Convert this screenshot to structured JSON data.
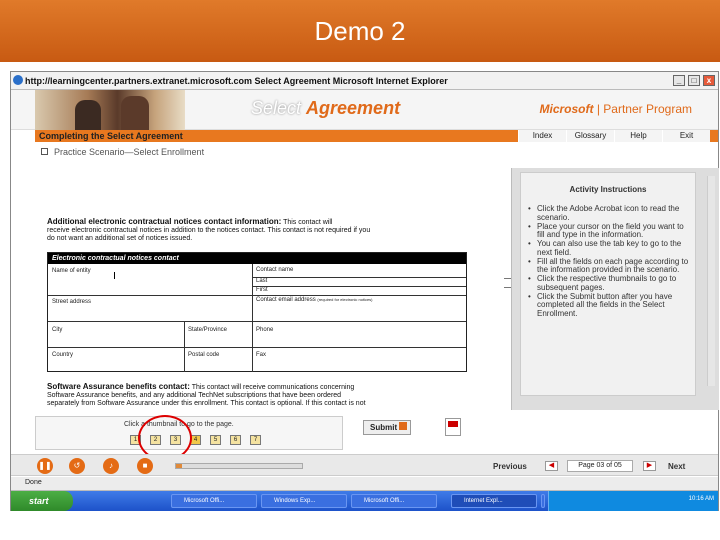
{
  "slide": {
    "title": "Demo 2"
  },
  "window": {
    "title": "http://learningcenter.partners.extranet.microsoft.com  Select Agreement  Microsoft Internet Explorer",
    "minimize": "_",
    "maximize": "□",
    "close": "x"
  },
  "banner": {
    "title_part1": "Select ",
    "title_part2": "Agreement",
    "brand": "Microsoft",
    "program": "| Partner Program"
  },
  "nav": {
    "section_title": "Completing the Select Agreement",
    "buttons": [
      "Index",
      "Glossary",
      "Help",
      "Exit"
    ]
  },
  "scenario": {
    "label": "Practice Scenario—Select Enrollment"
  },
  "form": {
    "contact_heading": "Additional electronic contractual notices contact information:",
    "contact_body_1": "This contact will",
    "contact_body_2": "receive electronic contractual notices in addition to the notices contact. This contact is not required if you",
    "contact_body_3": "do not want an additional set of notices issued.",
    "box_title": "Electronic contractual notices contact",
    "fields": {
      "name_of_entity": "Name of entity",
      "contact_name": "Contact name",
      "last": "Last",
      "first": "First",
      "contact_email": "Contact email address",
      "email_note": "(required for electronic notices)",
      "street_address": "Street address",
      "city": "City",
      "state_province": "State/Province",
      "phone": "Phone",
      "country": "Country",
      "postal_code": "Postal code",
      "fax": "Fax"
    },
    "sa_heading": "Software Assurance benefits contact:",
    "sa_body_1": "This contact will receive communications concerning",
    "sa_body_2": "Software Assurance benefits, and any additional TechNet subscriptions that have been ordered",
    "sa_body_3": "separately from Software Assurance under this enrollment. This contact is optional. If this contact is not"
  },
  "instructions": {
    "title": "Activity Instructions",
    "items": [
      "Click the Adobe Acrobat icon to read the scenario.",
      "Place your cursor on the field you want to fill and type in the information.",
      "You can also use the tab key to go to the next field.",
      "Fill all the fields on each page according to the information provided in the scenario.",
      "Click the respective thumbnails to go to subsequent pages.",
      "Click the Submit button after you have completed all the fields in the Select Enrollment."
    ]
  },
  "thumbnails": {
    "caption": "Click a thumbnail to go to the page.",
    "pages": [
      "1",
      "2",
      "3",
      "4",
      "5",
      "6",
      "7"
    ],
    "highlighted": "4"
  },
  "submit": {
    "label": "Submit"
  },
  "player": {
    "buttons": [
      "pause",
      "replay",
      "volume",
      "stop"
    ],
    "progress_fraction": 0.05,
    "previous_label": "Previous",
    "page_label": "Page 03 of 05",
    "next_label": "Next"
  },
  "status": {
    "text": "Done"
  },
  "taskbar": {
    "start_label": "start",
    "tasks": [
      "Microsoft Offi...",
      "Windows Exp...",
      "Microsoft Offi...",
      "Internet Expl...",
      "Microsoft Offi..."
    ],
    "clock": "10:16 AM"
  },
  "colors": {
    "accent_orange": "#e8781f",
    "header_orange": "#d0651a",
    "annotation_red": "#dd0000",
    "taskbar_blue": "#2a5fd4"
  }
}
